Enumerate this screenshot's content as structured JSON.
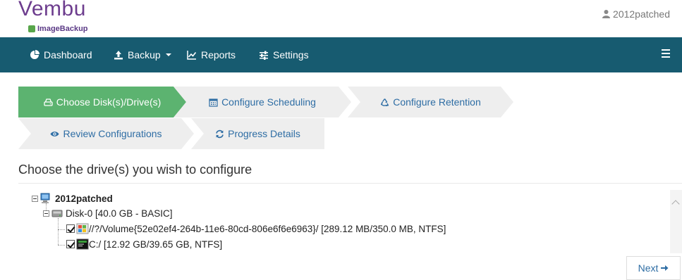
{
  "header": {
    "logo_text": "Vembu",
    "logo_subtext": "ImageBackup",
    "username": "2012patched"
  },
  "nav": {
    "items": [
      {
        "label": "Dashboard",
        "icon": "pie-chart-icon"
      },
      {
        "label": "Backup",
        "icon": "upload-icon"
      },
      {
        "label": "Reports",
        "icon": "line-chart-icon"
      },
      {
        "label": "Settings",
        "icon": "sliders-icon"
      }
    ],
    "menu_icon": "hamburger-icon"
  },
  "wizard": {
    "steps": [
      {
        "label": "Choose Disk(s)/Drive(s)",
        "icon": "hdd-icon",
        "active": true
      },
      {
        "label": "Configure Scheduling",
        "icon": "calendar-icon",
        "active": false
      },
      {
        "label": "Configure Retention",
        "icon": "recycle-icon",
        "active": false
      },
      {
        "label": "Review Configurations",
        "icon": "eye-icon",
        "active": false
      },
      {
        "label": "Progress Details",
        "icon": "refresh-icon",
        "active": false
      }
    ]
  },
  "content": {
    "title": "Choose the drive(s) you wish to configure",
    "tree": {
      "host": "2012patched",
      "disk": "Disk-0 [40.0 GB - BASIC]",
      "volumes": [
        {
          "label": "//?/Volume{52e02ef4-264b-11e6-80cd-806e6f6e6963}/ [289.12 MB/350.0 MB, NTFS]",
          "checked": true
        },
        {
          "label": "C:/ [12.92 GB/39.65 GB, NTFS]",
          "checked": true
        }
      ]
    },
    "next_label": "Next"
  },
  "colors": {
    "nav_bg": "#175b70",
    "active_step": "#5cb370",
    "link_blue": "#2e6da4",
    "brand_purple": "#6a2f8f"
  }
}
